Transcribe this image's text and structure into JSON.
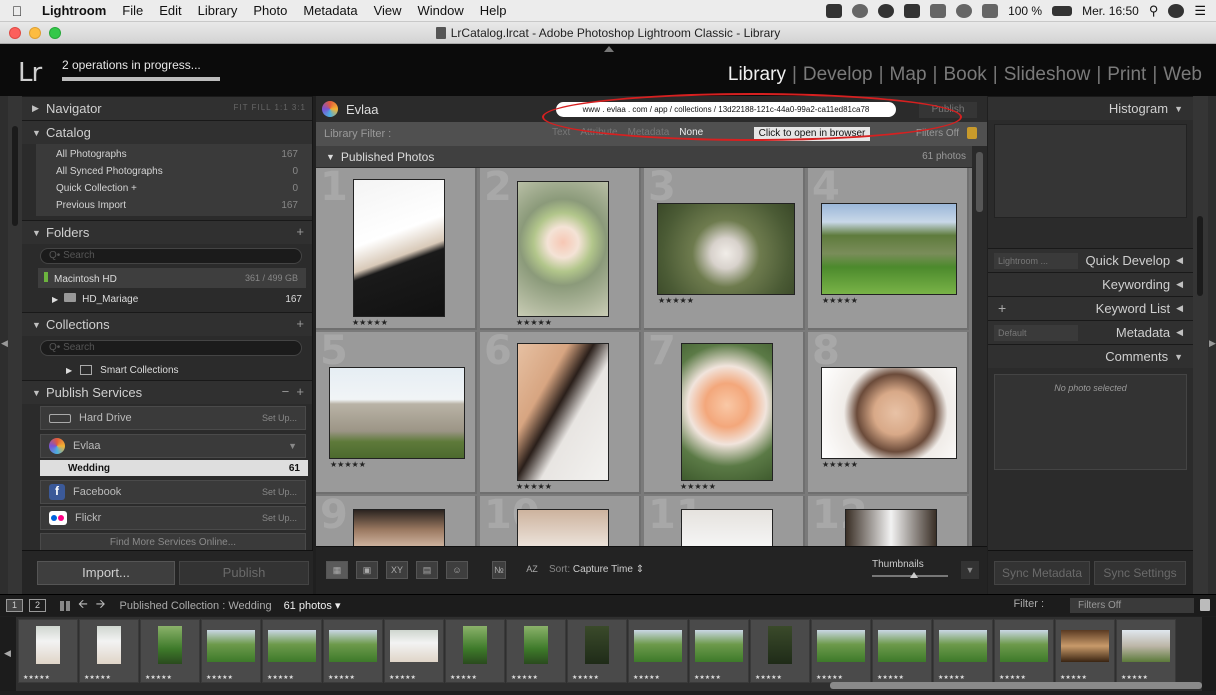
{
  "mac_menubar": {
    "app": "Lightroom",
    "items": [
      "File",
      "Edit",
      "Library",
      "Photo",
      "Metadata",
      "View",
      "Window",
      "Help"
    ],
    "battery": "100 %",
    "clock": "Mer. 16:50"
  },
  "window": {
    "title": "LrCatalog.lrcat - Adobe Photoshop Lightroom Classic - Library"
  },
  "identity": {
    "logo": "Lr",
    "status": "2 operations in progress...",
    "progress": 1.0
  },
  "modules": [
    "Library",
    "Develop",
    "Map",
    "Book",
    "Slideshow",
    "Print",
    "Web"
  ],
  "module_active": "Library",
  "left_panel": {
    "navigator": {
      "label": "Navigator",
      "options": "FIT  FILL  1:1  3:1"
    },
    "catalog": {
      "label": "Catalog",
      "rows": [
        {
          "label": "All Photographs",
          "count": "167"
        },
        {
          "label": "All Synced Photographs",
          "count": "0"
        },
        {
          "label": "Quick Collection +",
          "count": "0"
        },
        {
          "label": "Previous Import",
          "count": "167"
        }
      ]
    },
    "folders": {
      "label": "Folders",
      "search_placeholder": "Search",
      "volume": {
        "name": "Macintosh HD",
        "capacity": "361 / 499 GB"
      },
      "folder": {
        "name": "HD_Mariage",
        "count": "167"
      }
    },
    "collections": {
      "label": "Collections",
      "search_placeholder": "Search",
      "smart": "Smart Collections"
    },
    "publish": {
      "label": "Publish Services",
      "hard_drive": {
        "label": "Hard Drive",
        "action": "Set Up..."
      },
      "evlaa": {
        "label": "Evlaa"
      },
      "wedding": {
        "label": "Wedding",
        "count": "61"
      },
      "facebook": {
        "label": "Facebook",
        "action": "Set Up..."
      },
      "flickr": {
        "label": "Flickr",
        "action": "Set Up..."
      },
      "find_more": "Find More Services Online..."
    },
    "import_label": "Import...",
    "publish_label": "Publish"
  },
  "center": {
    "collection_name": "Evlaa",
    "url": "www . evlaa . com / app / collections / 13d22188-121c-44a0-99a2-ca11ed81ca78",
    "publish_btn": "Publish",
    "filter": {
      "label": "Library Filter :",
      "tabs": [
        "Text",
        "Attribute",
        "Metadata",
        "None"
      ],
      "hint": "Click to open in browser",
      "status": "Filters Off"
    },
    "grid": {
      "title": "Published Photos",
      "count": "61 photos",
      "stars": "★★★★★",
      "cells": [
        "1",
        "2",
        "3",
        "4",
        "5",
        "6",
        "7",
        "8",
        "9",
        "10",
        "11",
        "12"
      ]
    },
    "toolbar": {
      "sort_label": "Sort:",
      "sort_value": "Capture Time",
      "thumbnails": "Thumbnails",
      "thumb_size": 0.55
    }
  },
  "right_panel": {
    "histogram": "Histogram",
    "quick_develop": {
      "label": "Quick Develop",
      "preset": "Lightroom ..."
    },
    "keywording": "Keywording",
    "keyword_list": "Keyword List",
    "metadata": {
      "label": "Metadata",
      "preset": "Default"
    },
    "comments": "Comments",
    "no_photo": "No photo selected",
    "sync_metadata": "Sync Metadata",
    "sync_settings": "Sync Settings"
  },
  "filmstrip": {
    "breadcrumb": "Published Collection : Wedding",
    "count": "61 photos",
    "filter_label": "Filter :",
    "filter_value": "Filters Off",
    "stars": "★★★★★"
  },
  "colors": {
    "annotation": "#d72020",
    "background": "#1f1f1f"
  }
}
